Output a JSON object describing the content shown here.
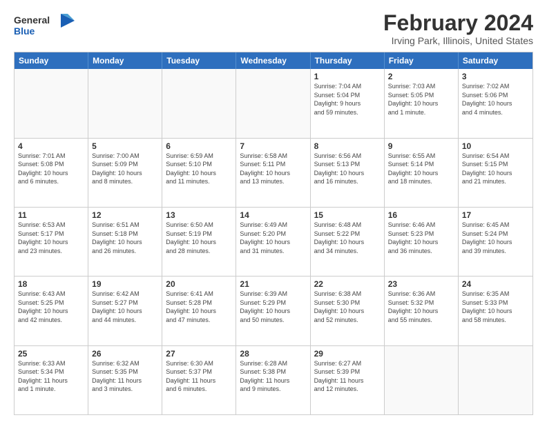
{
  "logo": {
    "general": "General",
    "blue": "Blue"
  },
  "title": "February 2024",
  "subtitle": "Irving Park, Illinois, United States",
  "calendar": {
    "headers": [
      "Sunday",
      "Monday",
      "Tuesday",
      "Wednesday",
      "Thursday",
      "Friday",
      "Saturday"
    ],
    "rows": [
      [
        {
          "day": "",
          "info": ""
        },
        {
          "day": "",
          "info": ""
        },
        {
          "day": "",
          "info": ""
        },
        {
          "day": "",
          "info": ""
        },
        {
          "day": "1",
          "info": "Sunrise: 7:04 AM\nSunset: 5:04 PM\nDaylight: 9 hours\nand 59 minutes."
        },
        {
          "day": "2",
          "info": "Sunrise: 7:03 AM\nSunset: 5:05 PM\nDaylight: 10 hours\nand 1 minute."
        },
        {
          "day": "3",
          "info": "Sunrise: 7:02 AM\nSunset: 5:06 PM\nDaylight: 10 hours\nand 4 minutes."
        }
      ],
      [
        {
          "day": "4",
          "info": "Sunrise: 7:01 AM\nSunset: 5:08 PM\nDaylight: 10 hours\nand 6 minutes."
        },
        {
          "day": "5",
          "info": "Sunrise: 7:00 AM\nSunset: 5:09 PM\nDaylight: 10 hours\nand 8 minutes."
        },
        {
          "day": "6",
          "info": "Sunrise: 6:59 AM\nSunset: 5:10 PM\nDaylight: 10 hours\nand 11 minutes."
        },
        {
          "day": "7",
          "info": "Sunrise: 6:58 AM\nSunset: 5:11 PM\nDaylight: 10 hours\nand 13 minutes."
        },
        {
          "day": "8",
          "info": "Sunrise: 6:56 AM\nSunset: 5:13 PM\nDaylight: 10 hours\nand 16 minutes."
        },
        {
          "day": "9",
          "info": "Sunrise: 6:55 AM\nSunset: 5:14 PM\nDaylight: 10 hours\nand 18 minutes."
        },
        {
          "day": "10",
          "info": "Sunrise: 6:54 AM\nSunset: 5:15 PM\nDaylight: 10 hours\nand 21 minutes."
        }
      ],
      [
        {
          "day": "11",
          "info": "Sunrise: 6:53 AM\nSunset: 5:17 PM\nDaylight: 10 hours\nand 23 minutes."
        },
        {
          "day": "12",
          "info": "Sunrise: 6:51 AM\nSunset: 5:18 PM\nDaylight: 10 hours\nand 26 minutes."
        },
        {
          "day": "13",
          "info": "Sunrise: 6:50 AM\nSunset: 5:19 PM\nDaylight: 10 hours\nand 28 minutes."
        },
        {
          "day": "14",
          "info": "Sunrise: 6:49 AM\nSunset: 5:20 PM\nDaylight: 10 hours\nand 31 minutes."
        },
        {
          "day": "15",
          "info": "Sunrise: 6:48 AM\nSunset: 5:22 PM\nDaylight: 10 hours\nand 34 minutes."
        },
        {
          "day": "16",
          "info": "Sunrise: 6:46 AM\nSunset: 5:23 PM\nDaylight: 10 hours\nand 36 minutes."
        },
        {
          "day": "17",
          "info": "Sunrise: 6:45 AM\nSunset: 5:24 PM\nDaylight: 10 hours\nand 39 minutes."
        }
      ],
      [
        {
          "day": "18",
          "info": "Sunrise: 6:43 AM\nSunset: 5:25 PM\nDaylight: 10 hours\nand 42 minutes."
        },
        {
          "day": "19",
          "info": "Sunrise: 6:42 AM\nSunset: 5:27 PM\nDaylight: 10 hours\nand 44 minutes."
        },
        {
          "day": "20",
          "info": "Sunrise: 6:41 AM\nSunset: 5:28 PM\nDaylight: 10 hours\nand 47 minutes."
        },
        {
          "day": "21",
          "info": "Sunrise: 6:39 AM\nSunset: 5:29 PM\nDaylight: 10 hours\nand 50 minutes."
        },
        {
          "day": "22",
          "info": "Sunrise: 6:38 AM\nSunset: 5:30 PM\nDaylight: 10 hours\nand 52 minutes."
        },
        {
          "day": "23",
          "info": "Sunrise: 6:36 AM\nSunset: 5:32 PM\nDaylight: 10 hours\nand 55 minutes."
        },
        {
          "day": "24",
          "info": "Sunrise: 6:35 AM\nSunset: 5:33 PM\nDaylight: 10 hours\nand 58 minutes."
        }
      ],
      [
        {
          "day": "25",
          "info": "Sunrise: 6:33 AM\nSunset: 5:34 PM\nDaylight: 11 hours\nand 1 minute."
        },
        {
          "day": "26",
          "info": "Sunrise: 6:32 AM\nSunset: 5:35 PM\nDaylight: 11 hours\nand 3 minutes."
        },
        {
          "day": "27",
          "info": "Sunrise: 6:30 AM\nSunset: 5:37 PM\nDaylight: 11 hours\nand 6 minutes."
        },
        {
          "day": "28",
          "info": "Sunrise: 6:28 AM\nSunset: 5:38 PM\nDaylight: 11 hours\nand 9 minutes."
        },
        {
          "day": "29",
          "info": "Sunrise: 6:27 AM\nSunset: 5:39 PM\nDaylight: 11 hours\nand 12 minutes."
        },
        {
          "day": "",
          "info": ""
        },
        {
          "day": "",
          "info": ""
        }
      ]
    ]
  }
}
